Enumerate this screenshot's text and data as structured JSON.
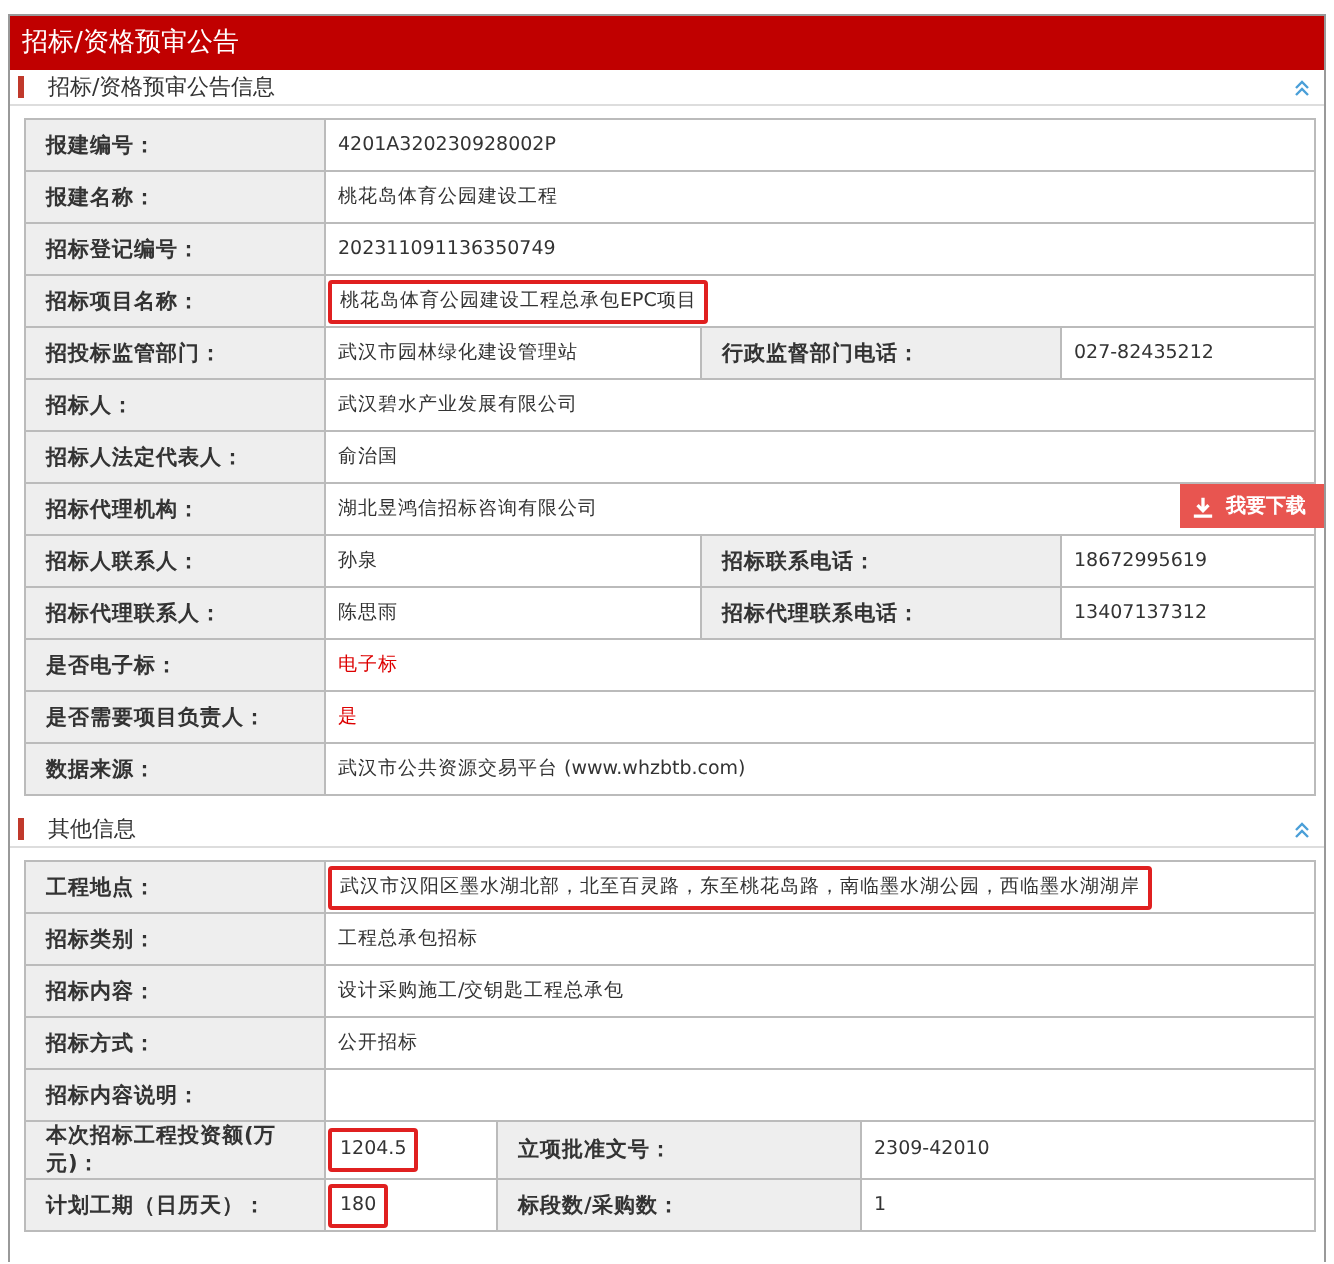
{
  "page_title": "招标/资格预审公告",
  "download_button": {
    "label": "我要下载"
  },
  "sections": [
    {
      "title": "招标/资格预审公告信息",
      "rows": [
        {
          "cells": [
            {
              "kind": "label",
              "text": "报建编号："
            },
            {
              "kind": "value",
              "text": "4201A320230928002P",
              "colspan": 3
            }
          ]
        },
        {
          "cells": [
            {
              "kind": "label",
              "text": "报建名称："
            },
            {
              "kind": "value",
              "text": "桃花岛体育公园建设工程",
              "colspan": 3
            }
          ]
        },
        {
          "cells": [
            {
              "kind": "label",
              "text": "招标登记编号："
            },
            {
              "kind": "value",
              "text": "202311091136350749",
              "colspan": 3
            }
          ]
        },
        {
          "cells": [
            {
              "kind": "label",
              "text": "招标项目名称："
            },
            {
              "kind": "value",
              "text": "桃花岛体育公园建设工程总承包EPC项目",
              "highlighted": true,
              "colspan": 3
            }
          ]
        },
        {
          "cells": [
            {
              "kind": "label",
              "text": "招投标监管部门："
            },
            {
              "kind": "value",
              "text": "武汉市园林绿化建设管理站"
            },
            {
              "kind": "label",
              "text": "行政监督部门电话："
            },
            {
              "kind": "value",
              "text": "027-82435212"
            }
          ]
        },
        {
          "cells": [
            {
              "kind": "label",
              "text": "招标人："
            },
            {
              "kind": "value",
              "text": "武汉碧水产业发展有限公司",
              "colspan": 3
            }
          ]
        },
        {
          "cells": [
            {
              "kind": "label",
              "text": "招标人法定代表人："
            },
            {
              "kind": "value",
              "text": "俞治国",
              "colspan": 3
            }
          ]
        },
        {
          "cells": [
            {
              "kind": "label",
              "text": "招标代理机构："
            },
            {
              "kind": "value",
              "text": "湖北昱鸿信招标咨询有限公司",
              "colspan": 3
            }
          ]
        },
        {
          "cells": [
            {
              "kind": "label",
              "text": "招标人联系人："
            },
            {
              "kind": "value",
              "text": "孙泉"
            },
            {
              "kind": "label",
              "text": "招标联系电话："
            },
            {
              "kind": "value",
              "text": "18672995619"
            }
          ]
        },
        {
          "cells": [
            {
              "kind": "label",
              "text": "招标代理联系人："
            },
            {
              "kind": "value",
              "text": "陈思雨"
            },
            {
              "kind": "label",
              "text": "招标代理联系电话："
            },
            {
              "kind": "value",
              "text": "13407137312"
            }
          ]
        },
        {
          "cells": [
            {
              "kind": "label",
              "text": "是否电子标："
            },
            {
              "kind": "value",
              "text": "电子标",
              "emphasis": true,
              "colspan": 3
            }
          ]
        },
        {
          "cells": [
            {
              "kind": "label",
              "text": "是否需要项目负责人："
            },
            {
              "kind": "value",
              "text": "是",
              "emphasis": true,
              "colspan": 3
            }
          ]
        },
        {
          "cells": [
            {
              "kind": "label",
              "text": "数据来源："
            },
            {
              "kind": "value",
              "text": " 武汉市公共资源交易平台 (www.whzbtb.com)",
              "colspan": 3
            }
          ]
        }
      ]
    },
    {
      "title": "其他信息",
      "rows": [
        {
          "cells": [
            {
              "kind": "label",
              "text": "工程地点："
            },
            {
              "kind": "value",
              "text": "武汉市汉阳区墨水湖北部，北至百灵路，东至桃花岛路，南临墨水湖公园，西临墨水湖湖岸",
              "highlighted": true,
              "colspan": 3
            }
          ]
        },
        {
          "cells": [
            {
              "kind": "label",
              "text": "招标类别："
            },
            {
              "kind": "value",
              "text": "工程总承包招标",
              "colspan": 3
            }
          ]
        },
        {
          "cells": [
            {
              "kind": "label",
              "text": "招标内容："
            },
            {
              "kind": "value",
              "text": "设计采购施工/交钥匙工程总承包",
              "colspan": 3
            }
          ]
        },
        {
          "cells": [
            {
              "kind": "label",
              "text": "招标方式："
            },
            {
              "kind": "value",
              "text": "公开招标",
              "colspan": 3
            }
          ]
        },
        {
          "cells": [
            {
              "kind": "label",
              "text": "招标内容说明："
            },
            {
              "kind": "value",
              "colspan": 3
            }
          ]
        },
        {
          "cells": [
            {
              "kind": "label",
              "text": "本次招标工程投资额(万元)："
            },
            {
              "kind": "value",
              "text": "1204.5",
              "highlighted": true
            },
            {
              "kind": "label",
              "text": "立项批准文号："
            },
            {
              "kind": "value",
              "text": "2309-42010"
            }
          ]
        },
        {
          "cells": [
            {
              "kind": "label",
              "text": "计划工期（日历天）："
            },
            {
              "kind": "value",
              "text": "180",
              "highlighted": true
            },
            {
              "kind": "label",
              "text": "标段数/采购数："
            },
            {
              "kind": "value",
              "text": "1"
            }
          ]
        }
      ]
    }
  ]
}
